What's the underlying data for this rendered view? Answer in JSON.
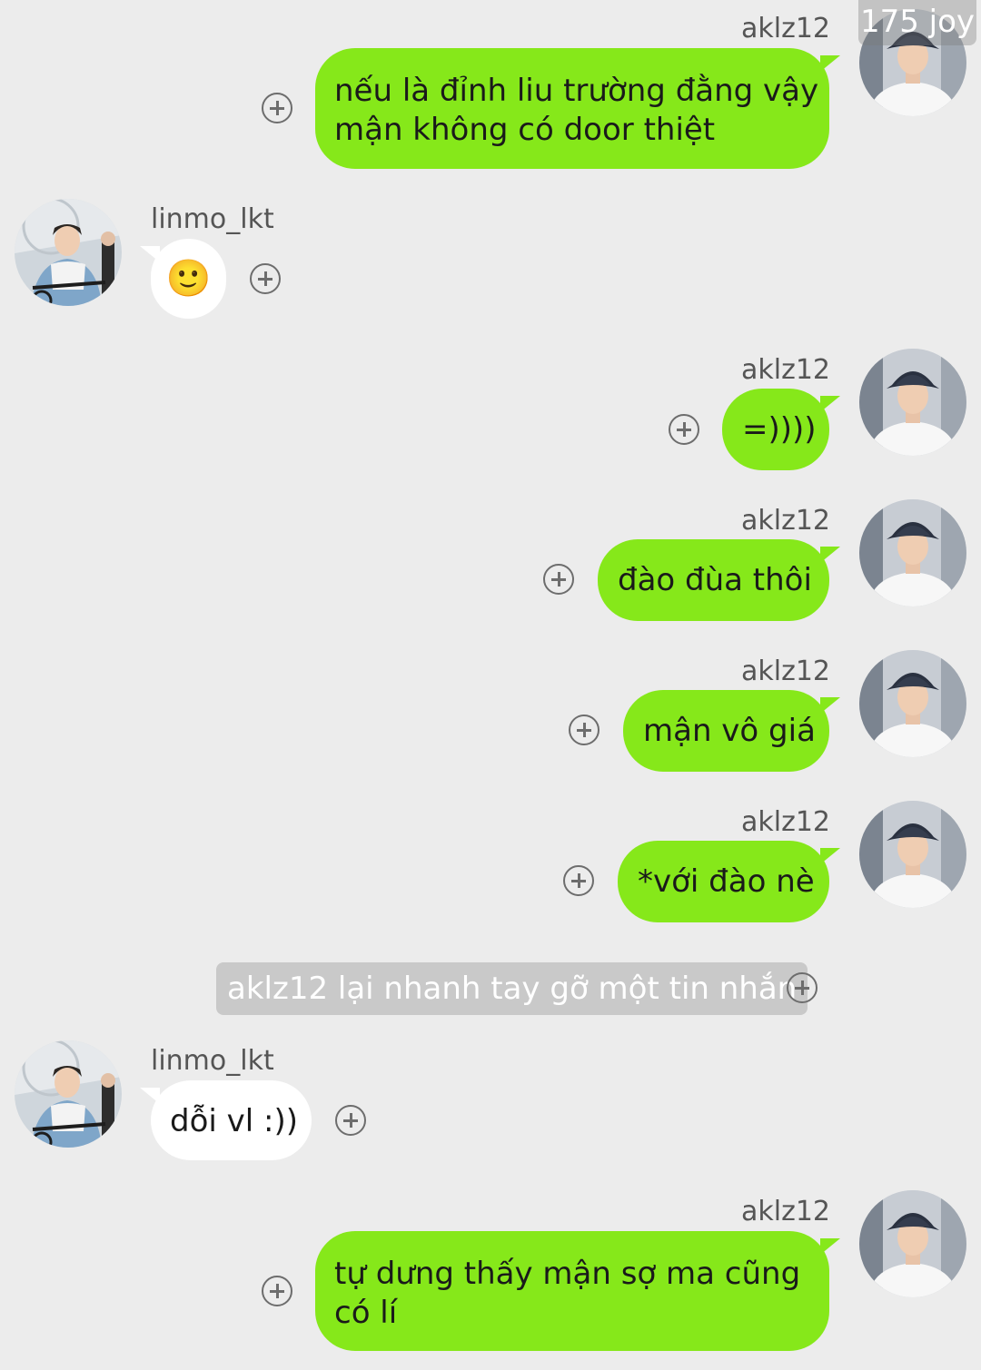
{
  "watermark": "175 joy",
  "messages": [
    {
      "sender": "aklz12",
      "side": "right",
      "lines": [
        "nếu là đỉnh liu trường đằng vậy",
        "mận không có door thiệt"
      ]
    },
    {
      "sender": "linmo_lkt",
      "side": "left",
      "emoji": "🙂",
      "emoji_name": "slightly-smiling-face"
    },
    {
      "sender": "aklz12",
      "side": "right",
      "lines": [
        "=))))"
      ]
    },
    {
      "sender": "aklz12",
      "side": "right",
      "lines": [
        "đào đùa thôi"
      ]
    },
    {
      "sender": "aklz12",
      "side": "right",
      "lines": [
        "mận vô giá"
      ]
    },
    {
      "sender": "aklz12",
      "side": "right",
      "lines": [
        "*với đào nè"
      ]
    },
    {
      "type": "system",
      "text": "aklz12 lại nhanh tay gỡ một tin nhắn"
    },
    {
      "sender": "linmo_lkt",
      "side": "left",
      "lines": [
        "dỗi vl :))"
      ]
    },
    {
      "sender": "aklz12",
      "side": "right",
      "lines": [
        "tự dưng thấy mận sợ ma cũng",
        "có lí"
      ]
    }
  ],
  "icons": {
    "react": "plus-circle-icon",
    "avatar_right": "bucket-hat-person-avatar",
    "avatar_left": "cyclist-person-avatar"
  },
  "colors": {
    "background": "#ececec",
    "own_bubble": "#86e81a",
    "other_bubble": "#ffffff",
    "system_note": "#c9c9c9"
  }
}
